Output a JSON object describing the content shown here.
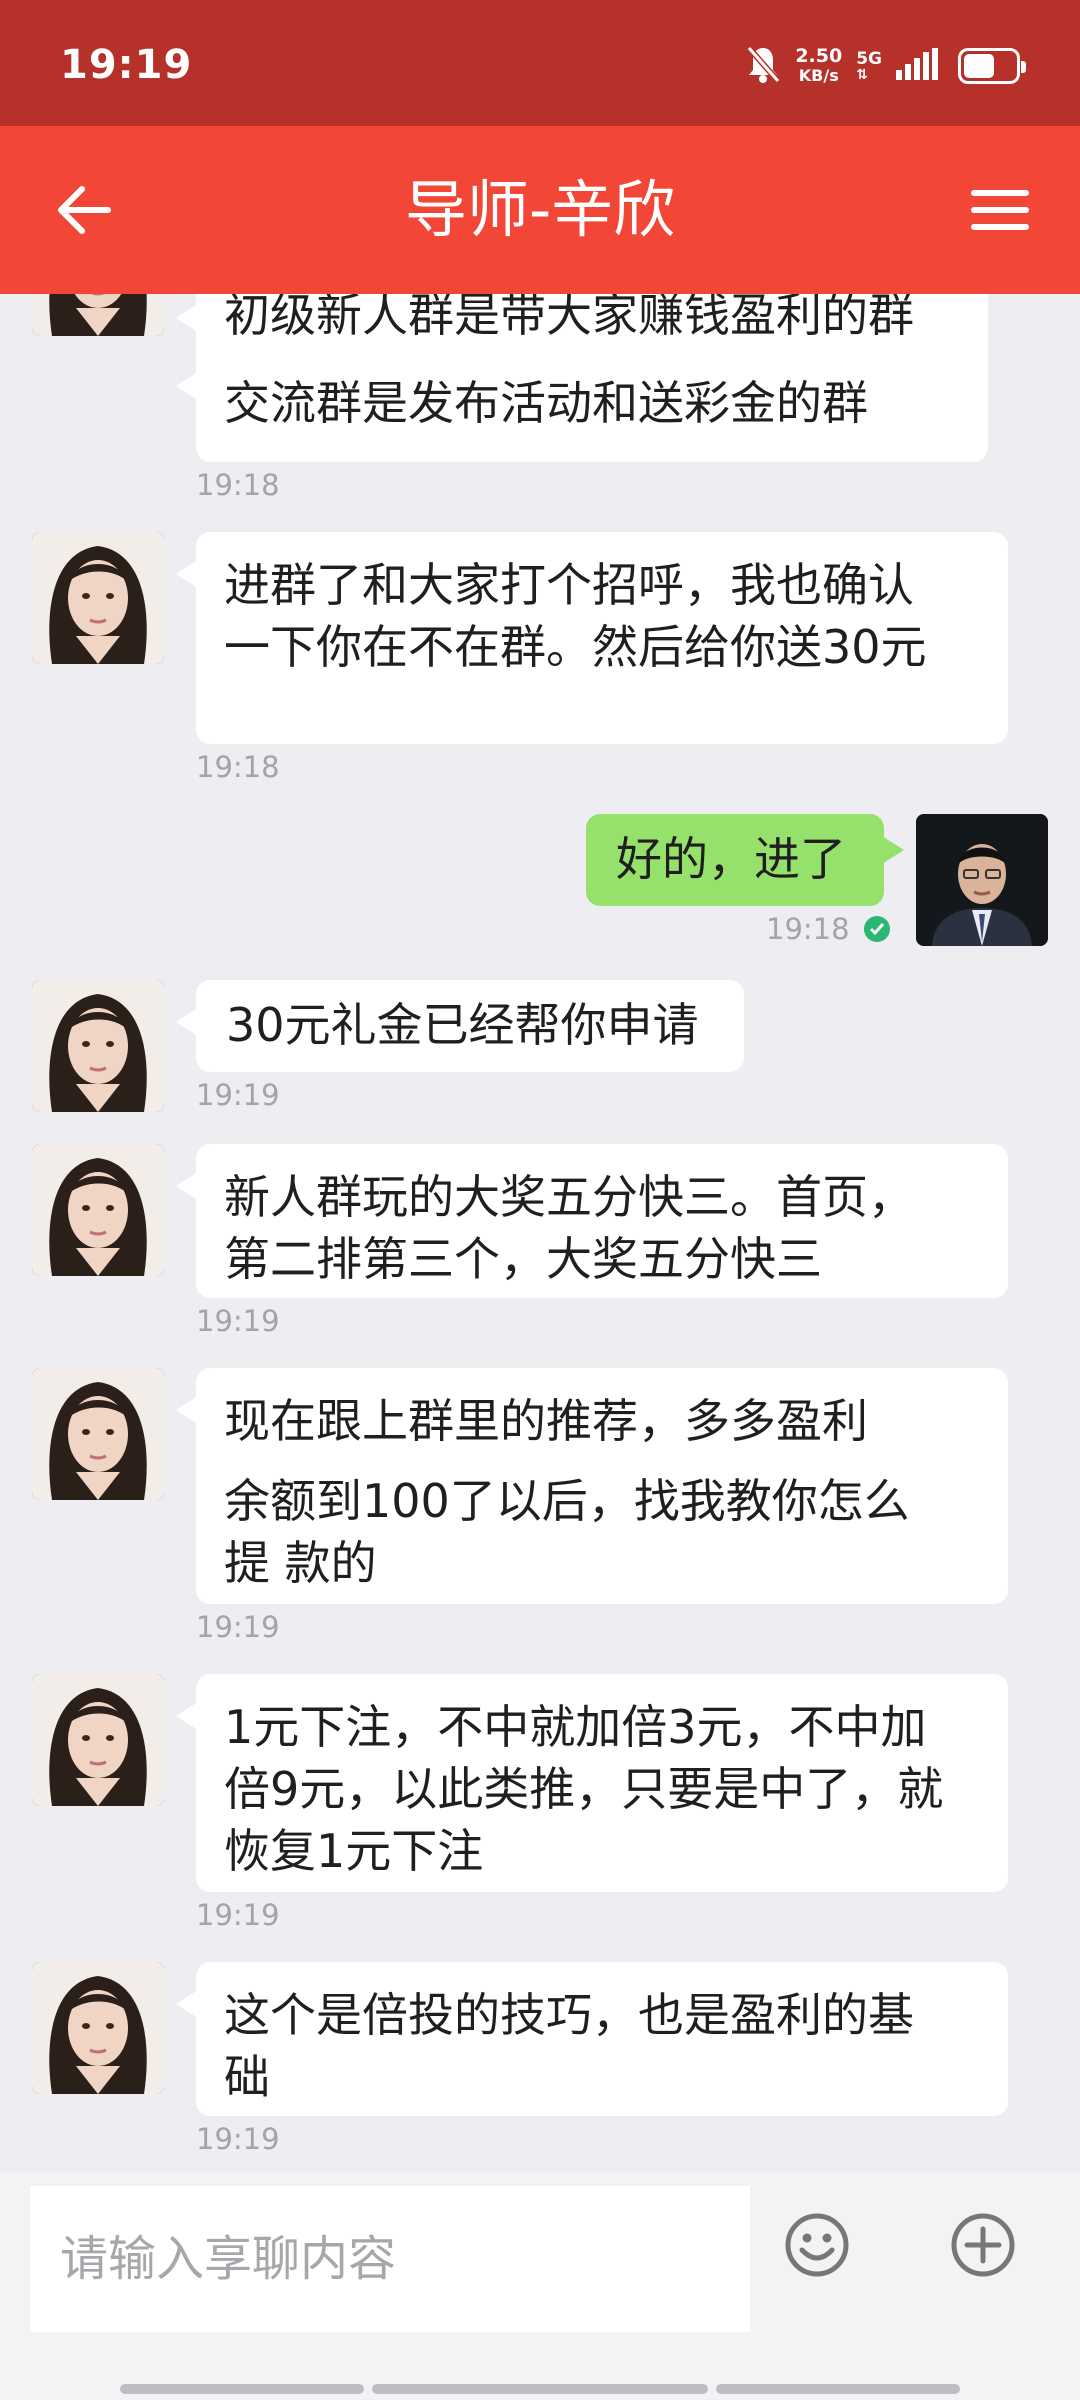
{
  "status_bar": {
    "time": "19:19",
    "net_speed_value": "2.50",
    "net_speed_unit": "KB/s",
    "network_type": "5G"
  },
  "header": {
    "title": "导师-辛欣"
  },
  "messages": [
    {
      "side": "left",
      "lines": [
        "初级新人群是带大家赚钱盈利的群",
        "交流群是发布活动和送彩金的群"
      ],
      "time": "19:18"
    },
    {
      "side": "left",
      "lines": [
        "进群了和大家打个招呼，我也确认",
        "一下你在不在群。然后给你送30元"
      ],
      "time": "19:18"
    },
    {
      "side": "right",
      "lines": [
        "好的，进了"
      ],
      "time": "19:18",
      "status": "read"
    },
    {
      "side": "left",
      "lines": [
        "30元礼金已经帮你申请"
      ],
      "time": "19:19"
    },
    {
      "side": "left",
      "lines": [
        "新人群玩的大奖五分快三。首页，",
        "第二排第三个，大奖五分快三"
      ],
      "time": "19:19"
    },
    {
      "side": "left",
      "lines": [
        "现在跟上群里的推荐，多多盈利",
        "余额到100了以后，找我教你怎么",
        "提 款的"
      ],
      "time": "19:19"
    },
    {
      "side": "left",
      "lines": [
        "1元下注，不中就加倍3元，不中加",
        "倍9元，以此类推，只要是中了，就",
        "恢复1元下注"
      ],
      "time": "19:19"
    },
    {
      "side": "left",
      "lines": [
        "这个是倍投的技巧，也是盈利的基",
        "础"
      ],
      "time": "19:19"
    }
  ],
  "input": {
    "placeholder": "请输入享聊内容"
  },
  "colors": {
    "status_bar": "#b7312b",
    "header": "#f24637",
    "incoming_bubble": "#ffffff",
    "outgoing_bubble": "#95e16b",
    "background": "#ededf2"
  },
  "icons": {
    "back": "arrow-left-icon",
    "menu": "hamburger-menu-icon",
    "emoji": "smiley-icon",
    "plus": "plus-circle-icon",
    "read": "check-circle-icon"
  }
}
